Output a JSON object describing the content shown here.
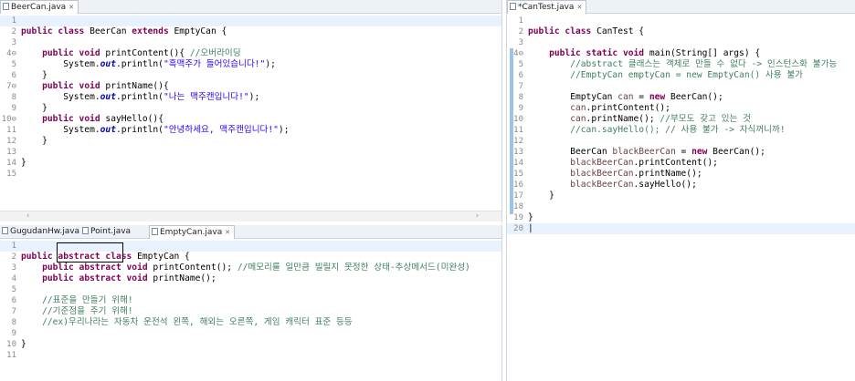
{
  "left_top": {
    "tab": "BeerCan.java",
    "close": "✕",
    "lines": [
      "",
      "public class BeerCan extends EmptyCan {",
      "",
      "    public void printContent(){ //오버라이딩",
      "        System.out.println(\"흑맥주가 들어있습니다!\");",
      "    }",
      "    public void printName(){",
      "        System.out.println(\"나는 맥주캔입니다!\");",
      "    }",
      "    public void sayHello(){",
      "        System.out.println(\"안녕하세요, 맥주캔입니다!\");",
      "    }",
      "",
      "}",
      ""
    ]
  },
  "left_bottom": {
    "tabs": [
      "GugudanHw.java",
      "Point.java",
      "EmptyCan.java"
    ],
    "close": "✕",
    "lines": [
      "",
      "public abstract class EmptyCan {",
      "    public abstract void printContent(); //메모리를 일만큼 빌릴지 못정한 상태-추상메서드(미완성)",
      "    public abstract void printName();",
      "",
      "    //표준을 만들기 위해!",
      "    //기준점을 주기 위해!",
      "    //ex)우리나라는 자동차 운전석 왼쪽, 해외는 오른쪽, 게임 캐릭터 표준 등등",
      "",
      "}",
      ""
    ]
  },
  "right": {
    "tab": "*CanTest.java",
    "close": "✕",
    "lines": [
      "",
      "public class CanTest {",
      "",
      "    public static void main(String[] args) {",
      "        //abstract 클래스는 객체로 만들 수 없다 -> 인스턴스화 불가능",
      "        //EmptyCan emptyCan = new EmptyCan() 사용 불가",
      "",
      "        EmptyCan can = new BeerCan();",
      "        can.printContent();",
      "        can.printName(); //부모도 갖고 있는 것",
      "        //can.sayHello(); // 사용 불가 -> 자식꺼니까!",
      "",
      "        BeerCan blackBeerCan = new BeerCan();",
      "        blackBeerCan.printContent();",
      "        blackBeerCan.printName();",
      "        blackBeerCan.sayHello();",
      "    }",
      "",
      "}",
      ""
    ]
  },
  "colors": {
    "keyword": "#7f0055",
    "comment": "#3f7f5f",
    "string": "#2a00ff",
    "current_line": "#e8f2fe"
  }
}
